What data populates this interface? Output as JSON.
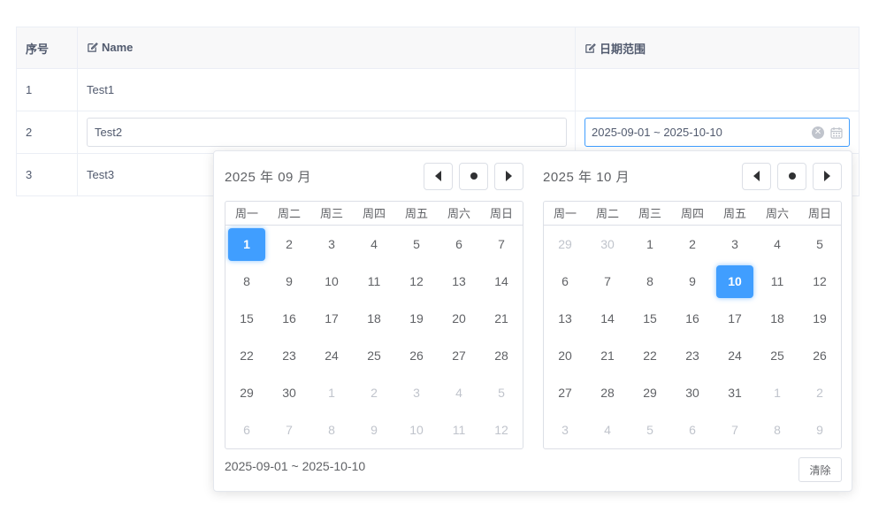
{
  "table": {
    "headers": {
      "seq": "序号",
      "name": "Name",
      "date": "日期范围"
    },
    "rows": [
      {
        "seq": "1",
        "name": "Test1",
        "date": ""
      },
      {
        "seq": "2",
        "name": "Test2",
        "date": "2025-09-01 ~ 2025-10-10"
      },
      {
        "seq": "3",
        "name": "Test3",
        "date": ""
      }
    ]
  },
  "picker": {
    "left": {
      "year_month": "2025 年  09 月",
      "weekdays": [
        "周一",
        "周二",
        "周三",
        "周四",
        "周五",
        "周六",
        "周日"
      ],
      "days": [
        {
          "n": "1",
          "m": false,
          "s": true
        },
        {
          "n": "2",
          "m": false
        },
        {
          "n": "3",
          "m": false
        },
        {
          "n": "4",
          "m": false
        },
        {
          "n": "5",
          "m": false
        },
        {
          "n": "6",
          "m": false
        },
        {
          "n": "7",
          "m": false
        },
        {
          "n": "8",
          "m": false
        },
        {
          "n": "9",
          "m": false
        },
        {
          "n": "10",
          "m": false
        },
        {
          "n": "11",
          "m": false
        },
        {
          "n": "12",
          "m": false
        },
        {
          "n": "13",
          "m": false
        },
        {
          "n": "14",
          "m": false
        },
        {
          "n": "15",
          "m": false
        },
        {
          "n": "16",
          "m": false
        },
        {
          "n": "17",
          "m": false
        },
        {
          "n": "18",
          "m": false
        },
        {
          "n": "19",
          "m": false
        },
        {
          "n": "20",
          "m": false
        },
        {
          "n": "21",
          "m": false
        },
        {
          "n": "22",
          "m": false
        },
        {
          "n": "23",
          "m": false
        },
        {
          "n": "24",
          "m": false
        },
        {
          "n": "25",
          "m": false
        },
        {
          "n": "26",
          "m": false
        },
        {
          "n": "27",
          "m": false
        },
        {
          "n": "28",
          "m": false
        },
        {
          "n": "29",
          "m": false
        },
        {
          "n": "30",
          "m": false
        },
        {
          "n": "1",
          "m": true
        },
        {
          "n": "2",
          "m": true
        },
        {
          "n": "3",
          "m": true
        },
        {
          "n": "4",
          "m": true
        },
        {
          "n": "5",
          "m": true
        },
        {
          "n": "6",
          "m": true
        },
        {
          "n": "7",
          "m": true
        },
        {
          "n": "8",
          "m": true
        },
        {
          "n": "9",
          "m": true
        },
        {
          "n": "10",
          "m": true
        },
        {
          "n": "11",
          "m": true
        },
        {
          "n": "12",
          "m": true
        }
      ]
    },
    "right": {
      "year_month": "2025 年  10 月",
      "weekdays": [
        "周一",
        "周二",
        "周三",
        "周四",
        "周五",
        "周六",
        "周日"
      ],
      "days": [
        {
          "n": "29",
          "m": true
        },
        {
          "n": "30",
          "m": true
        },
        {
          "n": "1",
          "m": false
        },
        {
          "n": "2",
          "m": false
        },
        {
          "n": "3",
          "m": false
        },
        {
          "n": "4",
          "m": false
        },
        {
          "n": "5",
          "m": false
        },
        {
          "n": "6",
          "m": false
        },
        {
          "n": "7",
          "m": false
        },
        {
          "n": "8",
          "m": false
        },
        {
          "n": "9",
          "m": false
        },
        {
          "n": "10",
          "m": false,
          "s": true
        },
        {
          "n": "11",
          "m": false
        },
        {
          "n": "12",
          "m": false
        },
        {
          "n": "13",
          "m": false
        },
        {
          "n": "14",
          "m": false
        },
        {
          "n": "15",
          "m": false
        },
        {
          "n": "16",
          "m": false
        },
        {
          "n": "17",
          "m": false
        },
        {
          "n": "18",
          "m": false
        },
        {
          "n": "19",
          "m": false
        },
        {
          "n": "20",
          "m": false
        },
        {
          "n": "21",
          "m": false
        },
        {
          "n": "22",
          "m": false
        },
        {
          "n": "23",
          "m": false
        },
        {
          "n": "24",
          "m": false
        },
        {
          "n": "25",
          "m": false
        },
        {
          "n": "26",
          "m": false
        },
        {
          "n": "27",
          "m": false
        },
        {
          "n": "28",
          "m": false
        },
        {
          "n": "29",
          "m": false
        },
        {
          "n": "30",
          "m": false
        },
        {
          "n": "31",
          "m": false
        },
        {
          "n": "1",
          "m": true
        },
        {
          "n": "2",
          "m": true
        },
        {
          "n": "3",
          "m": true
        },
        {
          "n": "4",
          "m": true
        },
        {
          "n": "5",
          "m": true
        },
        {
          "n": "6",
          "m": true
        },
        {
          "n": "7",
          "m": true
        },
        {
          "n": "8",
          "m": true
        },
        {
          "n": "9",
          "m": true
        }
      ]
    },
    "footer_range": "2025-09-01 ~ 2025-10-10",
    "clear_label": "清除"
  },
  "colors": {
    "accent": "#409eff",
    "border": "#dcdfe6",
    "muted": "#c0c4cc"
  },
  "icons": {
    "edit": "edit-icon",
    "clear": "clear-icon",
    "calendar": "calendar-icon",
    "prev": "caret-left-icon",
    "today": "dot-icon",
    "next": "caret-right-icon"
  }
}
